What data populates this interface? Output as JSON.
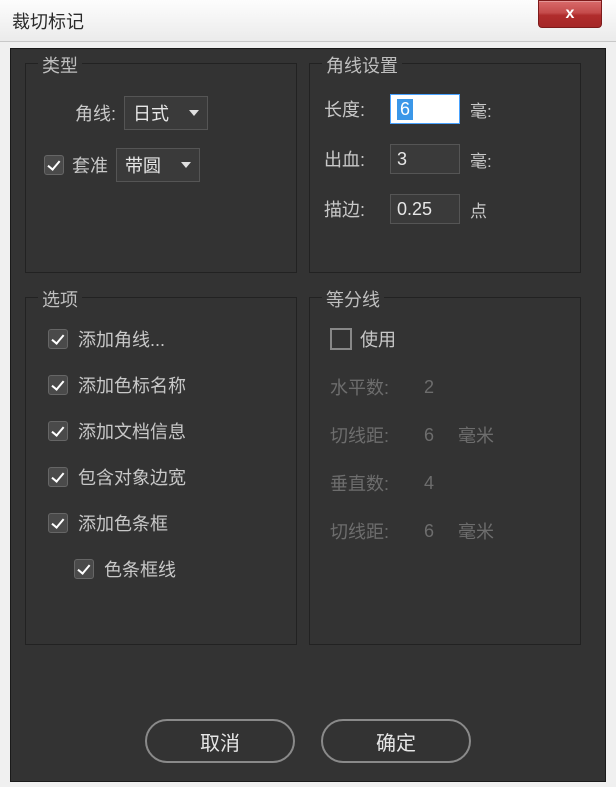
{
  "window": {
    "title": "裁切标记",
    "close_icon": "x"
  },
  "type_panel": {
    "legend": "类型",
    "corner_label": "角线:",
    "corner_select": "日式",
    "register_checkbox_label": "套准",
    "register_select": "带圆",
    "register_checked": true
  },
  "corner_settings": {
    "legend": "角线设置",
    "length_label": "长度:",
    "length_value": "6",
    "length_unit": "毫:",
    "bleed_label": "出血:",
    "bleed_value": "3",
    "bleed_unit": "毫:",
    "stroke_label": "描边:",
    "stroke_value": "0.25",
    "stroke_unit": "点"
  },
  "options_panel": {
    "legend": "选项",
    "items": [
      "添加角线...",
      "添加色标名称",
      "添加文档信息",
      "包含对象边宽",
      "添加色条框"
    ],
    "sub_item": "色条框线"
  },
  "divide_panel": {
    "legend": "等分线",
    "use_label": "使用",
    "rows": [
      {
        "label": "水平数:",
        "value": "2",
        "unit": ""
      },
      {
        "label": "切线距:",
        "value": "6",
        "unit": "毫米"
      },
      {
        "label": "垂直数:",
        "value": "4",
        "unit": ""
      },
      {
        "label": "切线距:",
        "value": "6",
        "unit": "毫米"
      }
    ]
  },
  "buttons": {
    "cancel": "取消",
    "ok": "确定"
  }
}
